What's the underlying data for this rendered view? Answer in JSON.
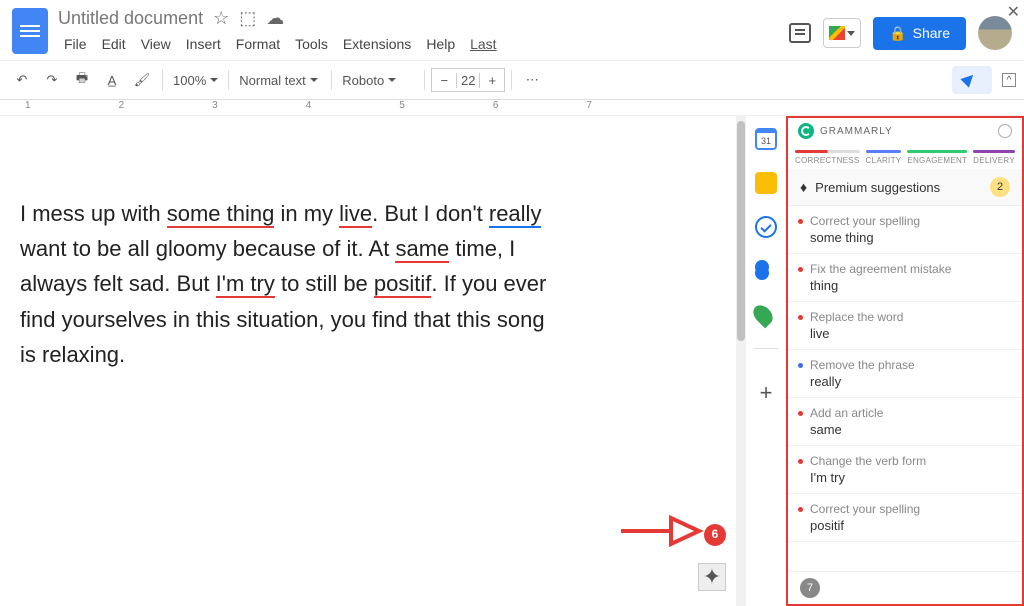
{
  "header": {
    "title": "Untitled document",
    "menus": [
      "File",
      "Edit",
      "View",
      "Insert",
      "Format",
      "Tools",
      "Extensions",
      "Help"
    ],
    "last": "Last",
    "share": "Share"
  },
  "toolbar": {
    "zoom": "100%",
    "style": "Normal text",
    "font": "Roboto",
    "size": "22"
  },
  "ruler": [
    "1",
    "2",
    "3",
    "4",
    "5",
    "6",
    "7"
  ],
  "document": {
    "l1a": "I mess up with ",
    "w_something": "some thing",
    "l1b": " in my ",
    "w_live": "live",
    "l1c": ". But I don't ",
    "w_really": "really",
    "l2a": "want to be all gloomy because of it. At ",
    "w_same": "same",
    "l2b": " time, I",
    "l3a": "always felt sad. But ",
    "w_imtry": "I'm try",
    "l3b": " to still be ",
    "w_positif": "positif",
    "l3c": ". If you ever",
    "l4": "find yourselves in this situation, you find that this song",
    "l5": "is relaxing."
  },
  "error_count": "6",
  "rightbar": {
    "cal": "31"
  },
  "grammarly": {
    "brand": "GRAMMARLY",
    "tabs": [
      "CORRECTNESS",
      "CLARITY",
      "ENGAGEMENT",
      "DELIVERY"
    ],
    "premium_label": "Premium suggestions",
    "premium_count": "2",
    "items": [
      {
        "title": "Correct your spelling",
        "word": "some thing",
        "dot": "red"
      },
      {
        "title": "Fix the agreement mistake",
        "word": "thing",
        "dot": "red"
      },
      {
        "title": "Replace the word",
        "word": "live",
        "dot": "red"
      },
      {
        "title": "Remove the phrase",
        "word": "really",
        "dot": "blue"
      },
      {
        "title": "Add an article",
        "word": "same",
        "dot": "red"
      },
      {
        "title": "Change the verb form",
        "word": "I'm try",
        "dot": "red"
      },
      {
        "title": "Correct your spelling",
        "word": "positif",
        "dot": "red"
      }
    ],
    "footer_count": "7"
  },
  "close": "✕"
}
